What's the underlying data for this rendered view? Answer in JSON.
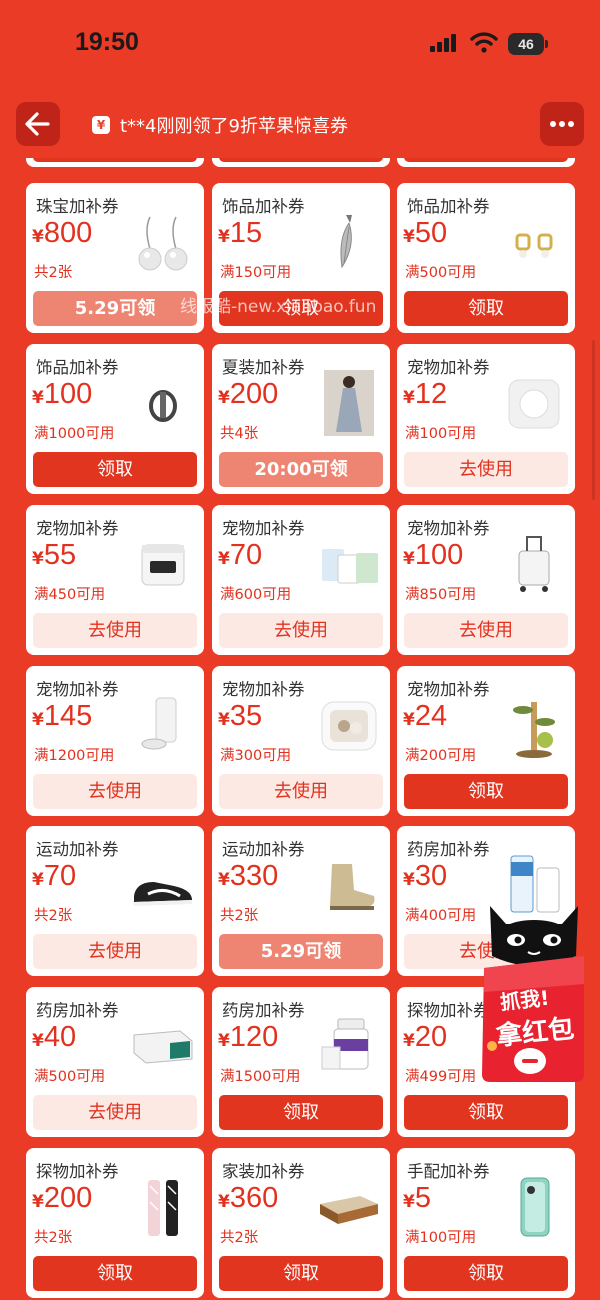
{
  "status_bar": {
    "time": "19:50",
    "battery": "46"
  },
  "nav": {
    "marquee": "t**4刚刚领了9折苹果惊喜券"
  },
  "watermark": "线报酷-new.xianbao.fun",
  "floating_badge": {
    "line1": "抓我!",
    "line2": "拿红包"
  },
  "coupons": [
    {
      "title": "珠宝加补券",
      "symbol": "¥",
      "amount": "800",
      "condition": "共2张",
      "button": "5.29可领",
      "state": "timed",
      "image": "pearl-earrings"
    },
    {
      "title": "饰品加补券",
      "symbol": "¥",
      "amount": "15",
      "condition": "满150可用",
      "button": "领取",
      "state": "claim",
      "image": "feather-pendant"
    },
    {
      "title": "饰品加补券",
      "symbol": "¥",
      "amount": "50",
      "condition": "满500可用",
      "button": "领取",
      "state": "claim",
      "image": "gold-earrings"
    },
    {
      "title": "饰品加补券",
      "symbol": "¥",
      "amount": "100",
      "condition": "满1000可用",
      "button": "领取",
      "state": "claim",
      "image": "ring"
    },
    {
      "title": "夏装加补券",
      "symbol": "¥",
      "amount": "200",
      "condition": "共4张",
      "button": "20:00可领",
      "state": "timed",
      "image": "dress"
    },
    {
      "title": "宠物加补券",
      "symbol": "¥",
      "amount": "12",
      "condition": "满100可用",
      "button": "去使用",
      "state": "use",
      "image": "pet-box"
    },
    {
      "title": "宠物加补券",
      "symbol": "¥",
      "amount": "55",
      "condition": "满450可用",
      "button": "去使用",
      "state": "use",
      "image": "water-fountain"
    },
    {
      "title": "宠物加补券",
      "symbol": "¥",
      "amount": "70",
      "condition": "满600可用",
      "button": "去使用",
      "state": "use",
      "image": "litter-boxes"
    },
    {
      "title": "宠物加补券",
      "symbol": "¥",
      "amount": "100",
      "condition": "满850可用",
      "button": "去使用",
      "state": "use",
      "image": "pet-trolley"
    },
    {
      "title": "宠物加补券",
      "symbol": "¥",
      "amount": "145",
      "condition": "满1200可用",
      "button": "去使用",
      "state": "use",
      "image": "pet-feeder"
    },
    {
      "title": "宠物加补券",
      "symbol": "¥",
      "amount": "35",
      "condition": "满300可用",
      "button": "去使用",
      "state": "use",
      "image": "pet-dryer"
    },
    {
      "title": "宠物加补券",
      "symbol": "¥",
      "amount": "24",
      "condition": "满200可用",
      "button": "领取",
      "state": "claim",
      "image": "cat-tree"
    },
    {
      "title": "运动加补券",
      "symbol": "¥",
      "amount": "70",
      "condition": "共2张",
      "button": "去使用",
      "state": "use",
      "image": "sneaker"
    },
    {
      "title": "运动加补券",
      "symbol": "¥",
      "amount": "330",
      "condition": "共2张",
      "button": "5.29可领",
      "state": "timed",
      "image": "boot"
    },
    {
      "title": "药房加补券",
      "symbol": "¥",
      "amount": "30",
      "condition": "满400可用",
      "button": "去使用",
      "state": "use",
      "image": "medicine-bottles"
    },
    {
      "title": "药房加补券",
      "symbol": "¥",
      "amount": "40",
      "condition": "满500可用",
      "button": "去使用",
      "state": "use",
      "image": "medicine-box"
    },
    {
      "title": "药房加补券",
      "symbol": "¥",
      "amount": "120",
      "condition": "满1500可用",
      "button": "领取",
      "state": "claim",
      "image": "supplement-jar"
    },
    {
      "title": "探物加补券",
      "symbol": "¥",
      "amount": "20",
      "condition": "满499可用",
      "button": "领取",
      "state": "claim",
      "image": "misc-item"
    },
    {
      "title": "探物加补券",
      "symbol": "¥",
      "amount": "200",
      "condition": "共2张",
      "button": "领取",
      "state": "claim",
      "image": "scarves"
    },
    {
      "title": "家装加补券",
      "symbol": "¥",
      "amount": "360",
      "condition": "共2张",
      "button": "领取",
      "state": "claim",
      "image": "bed"
    },
    {
      "title": "手配加补券",
      "symbol": "¥",
      "amount": "5",
      "condition": "满100可用",
      "button": "领取",
      "state": "claim",
      "image": "phone"
    }
  ]
}
